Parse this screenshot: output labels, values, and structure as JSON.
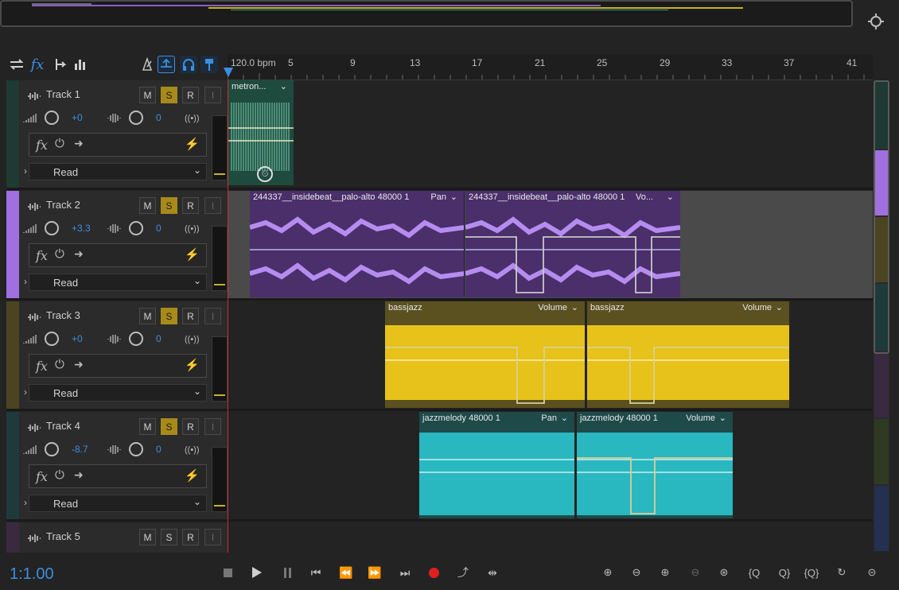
{
  "colors": {
    "track1": "#1f3a32",
    "track2": "#a070e0",
    "track3": "#4a4420",
    "track4": "#1f3a3a",
    "track5": "#3a2a40",
    "playhead": "#3b8fe0",
    "solo_on": "#a88a1a",
    "value_blue": "#3b8fe0",
    "record_red": "#e02020"
  },
  "toolbar": {
    "icons": [
      "swap-icon",
      "fx-icon",
      "send-icon",
      "eq-icon",
      "metronome-icon",
      "loop-icon",
      "headphones-icon",
      "marker-icon"
    ]
  },
  "ruler": {
    "tempo": "120.0 bpm",
    "labels": [
      "5",
      "9",
      "13",
      "17",
      "21",
      "25",
      "29",
      "33",
      "37",
      "41"
    ]
  },
  "tracks": [
    {
      "name": "Track 1",
      "volume": "+0",
      "pan": "0",
      "automation": "Read",
      "mute": "M",
      "solo": "S",
      "record": "R",
      "input": "I",
      "solo_active": true
    },
    {
      "name": "Track 2",
      "volume": "+3.3",
      "pan": "0",
      "automation": "Read",
      "mute": "M",
      "solo": "S",
      "record": "R",
      "input": "I",
      "solo_active": true
    },
    {
      "name": "Track 3",
      "volume": "+0",
      "pan": "0",
      "automation": "Read",
      "mute": "M",
      "solo": "S",
      "record": "R",
      "input": "I",
      "solo_active": true
    },
    {
      "name": "Track 4",
      "volume": "-8.7",
      "pan": "0",
      "automation": "Read",
      "mute": "M",
      "solo": "S",
      "record": "R",
      "input": "I",
      "solo_active": true
    },
    {
      "name": "Track 5",
      "mute": "M",
      "solo": "S",
      "record": "R",
      "input": "I",
      "solo_active": false
    }
  ],
  "clips": {
    "t1c1": {
      "title": "metron..."
    },
    "t2c1": {
      "title": "244337__insidebeat__palo-alto 48000 1",
      "env": "Pan"
    },
    "t2c2": {
      "title": "244337__insidebeat__palo-alto 48000 1",
      "env": "Vo..."
    },
    "t3c1": {
      "title": "bassjazz",
      "env": "Volume"
    },
    "t3c2": {
      "title": "bassjazz",
      "env": "Volume"
    },
    "t4c1": {
      "title": "jazzmelody 48000 1",
      "env": "Pan"
    },
    "t4c2": {
      "title": "jazzmelody 48000 1",
      "env": "Volume"
    }
  },
  "transport": {
    "time": "1:1.00"
  }
}
